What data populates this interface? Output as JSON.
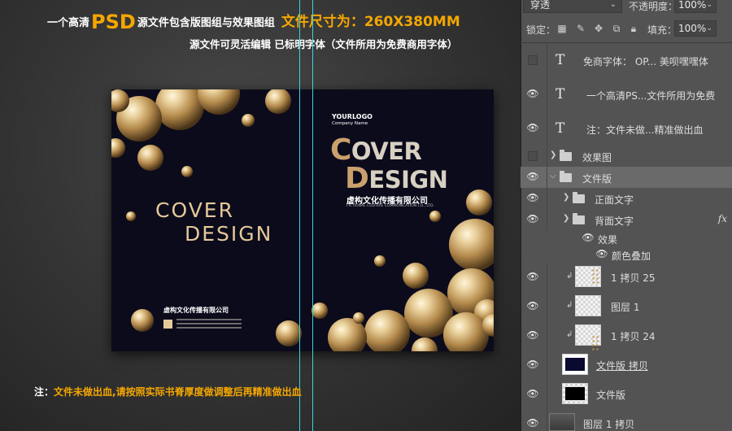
{
  "canvas": {
    "header_prefix": "一个高清",
    "header_psd": "PSD",
    "header_rest": "源文件包含版图组与效果图组",
    "header_size": "文件尺寸为：260X380MM",
    "header_line2": "源文件可灵活编辑 已标明字体（文件所用为免费商用字体）",
    "note_label": "注：",
    "note_text": "文件未做出血,请按照实际书脊厚度做调整后再精准做出血",
    "back_title_1": "COVER",
    "back_title_2": "DESIGN",
    "back_company": "虚构文化传播有限公司",
    "logo_main": "YOURLOGO",
    "logo_sub": "Company Name",
    "front_title_1_big": "C",
    "front_title_1_rest": "OVER",
    "front_title_2_big": "D",
    "front_title_2_rest": "ESIGN",
    "front_company": "虚构文化传播有限公司",
    "front_company_en": "FICTIONAL CULTURE COMMUNICATION CO., LTD.",
    "colors": {
      "accent": "#f5a700",
      "cover_bg": "#0b0b1c",
      "gold": "#caa06c",
      "guide": "#38d4e6"
    }
  },
  "panel": {
    "blend_mode": "穿透",
    "opacity_label": "不透明度：",
    "opacity_value": "100%",
    "lock_label": "锁定：",
    "fill_label": "填充：",
    "fill_value": "100%",
    "lock_icons": [
      "checkerboard-icon",
      "brush-icon",
      "move-icon",
      "artboard-icon",
      "lock-icon"
    ]
  },
  "layers": [
    {
      "name": "免商字体：  OP...   美呗嘿嘿体",
      "kind": "text",
      "visible": false
    },
    {
      "name": "一个高清PS...文件所用为免费",
      "kind": "text",
      "visible": true
    },
    {
      "name": "注：文件未做...精准做出血",
      "kind": "text",
      "visible": true
    },
    {
      "name": "效果图",
      "kind": "group",
      "visible": false
    },
    {
      "name": "文件版",
      "kind": "group-open",
      "visible": true
    },
    {
      "name": "正面文字",
      "kind": "group",
      "visible": true
    },
    {
      "name": "背面文字",
      "kind": "group",
      "visible": true,
      "fx": "fx"
    },
    {
      "name": "效果",
      "kind": "effects",
      "visible": true
    },
    {
      "name": "颜色叠加",
      "kind": "effect",
      "visible": true
    },
    {
      "name": "1 拷贝 25",
      "kind": "pixel",
      "visible": true
    },
    {
      "name": "图层 1",
      "kind": "pixel",
      "visible": true
    },
    {
      "name": "1 拷贝 24",
      "kind": "pixel",
      "visible": true
    },
    {
      "name": "文件版 拷贝",
      "kind": "shape-dark",
      "visible": true
    },
    {
      "name": "文件版",
      "kind": "shape-black",
      "visible": true
    },
    {
      "name": "图层 1 拷贝",
      "kind": "pixel-gray",
      "visible": true
    }
  ]
}
